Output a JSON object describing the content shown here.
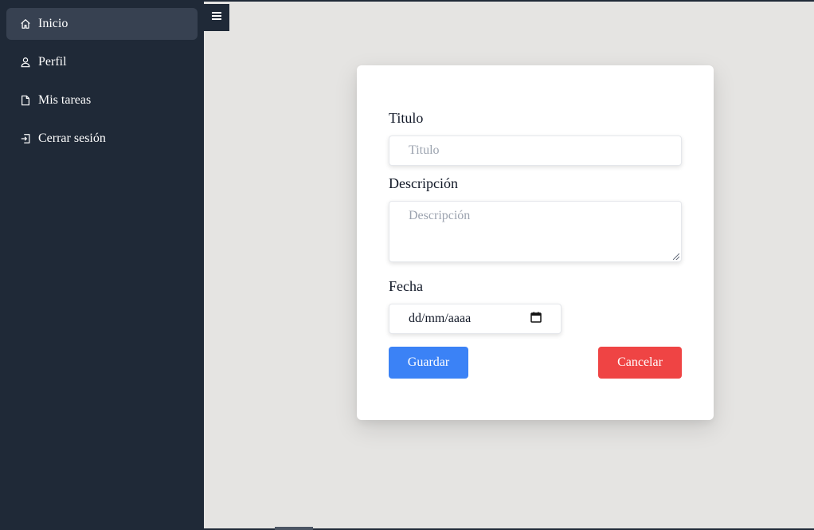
{
  "sidebar": {
    "items": [
      {
        "label": "Inicio",
        "icon": "home-icon"
      },
      {
        "label": "Perfil",
        "icon": "user-icon"
      },
      {
        "label": "Mis tareas",
        "icon": "document-icon"
      },
      {
        "label": "Cerrar sesión",
        "icon": "logout-icon"
      }
    ]
  },
  "form": {
    "title_label": "Titulo",
    "title_placeholder": "Titulo",
    "description_label": "Descripción",
    "description_placeholder": "Descripción",
    "date_label": "Fecha",
    "date_placeholder": "dd/mm/aaaa",
    "save_label": "Guardar",
    "cancel_label": "Cancelar"
  },
  "colors": {
    "sidebar_bg": "#1f2937",
    "active_item_bg": "#374151",
    "main_bg": "#e5e4e2",
    "save_button": "#3b82f6",
    "cancel_button": "#ef4444"
  }
}
